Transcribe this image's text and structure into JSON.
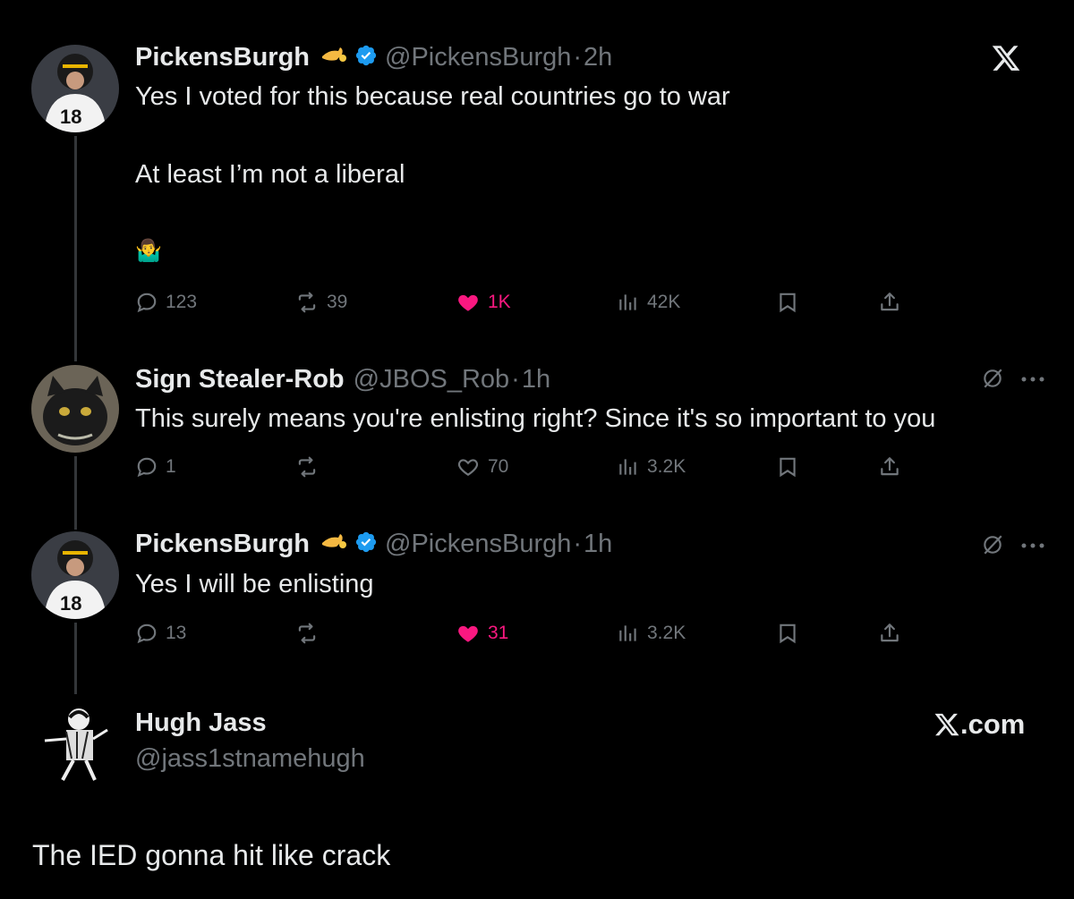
{
  "close_logo": "x-logo-icon",
  "tweets": [
    {
      "name": "PickensBurgh",
      "handle": "@PickensBurgh",
      "time": "2h",
      "lines": [
        "Yes I voted for this because real countries go to war",
        "At least I’m not a liberal",
        "🤷‍♂️"
      ],
      "replies": "123",
      "retweets": "39",
      "likes": "1K",
      "views": "42K"
    },
    {
      "name": "Sign Stealer-Rob",
      "handle": "@JBOS_Rob",
      "time": "1h",
      "lines": [
        "This surely means you're enlisting right? Since it's so important to you"
      ],
      "replies": "1",
      "retweets": "",
      "likes": "70",
      "views": "3.2K"
    },
    {
      "name": "PickensBurgh",
      "handle": "@PickensBurgh",
      "time": "1h",
      "lines": [
        "Yes I will be enlisting"
      ],
      "replies": "13",
      "retweets": "",
      "likes": "31",
      "views": "3.2K"
    }
  ],
  "footer": {
    "name": "Hugh Jass",
    "handle": "@jass1stnamehugh",
    "site": "X.com",
    "caption": "The IED gonna hit like crack"
  },
  "colors": {
    "background": "#000000",
    "text": "#e7e9ea",
    "muted": "#71767b",
    "like": "#f91880",
    "verified": "#1d9bf0"
  }
}
